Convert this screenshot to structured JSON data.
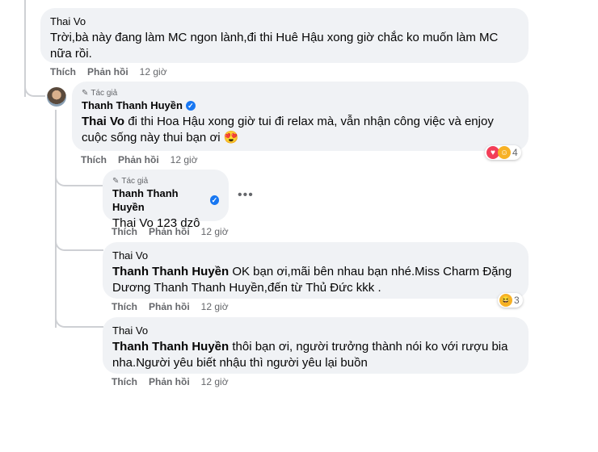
{
  "comments": [
    {
      "author": "Thai Vo",
      "text": "Trời,bà này đang làm MC ngon lành,đi thi Huê Hậu xong giờ chắc ko muốn làm MC nữa rồi.",
      "actions": {
        "like": "Thích",
        "reply": "Phản hồi",
        "time": "12 giờ"
      }
    },
    {
      "badge": "Tác giả",
      "author": "Thanh Thanh Huyền",
      "mention": "Thai Vo",
      "text": " đi thi Hoa Hậu xong giờ tui đi relax mà, vẫn nhận công việc và enjoy cuộc sống này thui bạn ơi 😍",
      "actions": {
        "like": "Thích",
        "reply": "Phản hồi",
        "time": "12 giờ"
      },
      "reaction_count": "4",
      "reactions": [
        "love-icon",
        "care-icon"
      ]
    },
    {
      "badge": "Tác giả",
      "author": "Thanh Thanh Huyền",
      "mention": "Thai Vo",
      "text": " 123 dzô",
      "actions": {
        "like": "Thích",
        "reply": "Phản hồi",
        "time": "12 giờ"
      },
      "more": "•••"
    },
    {
      "author": "Thai Vo",
      "mention": "Thanh Thanh Huyền",
      "text": " OK bạn ơi,mãi bên nhau bạn nhé.Miss Charm Đặng Dương Thanh Thanh Huyền,đến từ Thủ Đức kkk .",
      "actions": {
        "like": "Thích",
        "reply": "Phản hồi",
        "time": "12 giờ"
      },
      "reaction_count": "3",
      "reactions": [
        "haha-icon"
      ]
    },
    {
      "author": "Thai Vo",
      "mention": "Thanh Thanh Huyền",
      "text": " thôi bạn ơi, người trưởng thành nói ko với rượu bia nha.Người yêu biết nhậu thì người yêu lại buồn",
      "actions": {
        "like": "Thích",
        "reply": "Phản hồi",
        "time": "12 giờ"
      }
    }
  ],
  "colors": {
    "bubble": "#f0f2f5",
    "secondary_text": "#65676b",
    "verified": "#1877f2",
    "love": "#f33e58",
    "haha": "#f7b125"
  }
}
